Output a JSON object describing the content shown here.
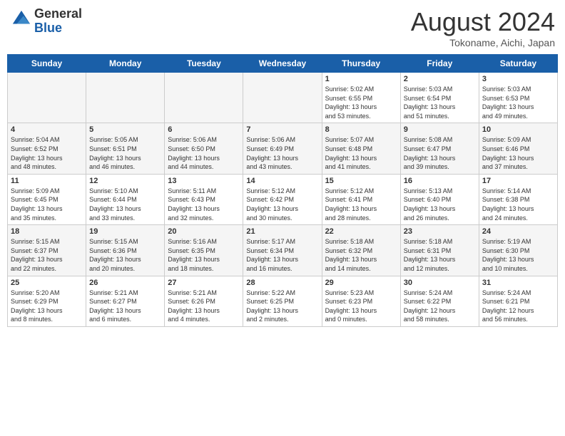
{
  "header": {
    "logo_line1": "General",
    "logo_line2": "Blue",
    "month_title": "August 2024",
    "location": "Tokoname, Aichi, Japan"
  },
  "weekdays": [
    "Sunday",
    "Monday",
    "Tuesday",
    "Wednesday",
    "Thursday",
    "Friday",
    "Saturday"
  ],
  "weeks": [
    [
      {
        "day": "",
        "info": ""
      },
      {
        "day": "",
        "info": ""
      },
      {
        "day": "",
        "info": ""
      },
      {
        "day": "",
        "info": ""
      },
      {
        "day": "1",
        "info": "Sunrise: 5:02 AM\nSunset: 6:55 PM\nDaylight: 13 hours\nand 53 minutes."
      },
      {
        "day": "2",
        "info": "Sunrise: 5:03 AM\nSunset: 6:54 PM\nDaylight: 13 hours\nand 51 minutes."
      },
      {
        "day": "3",
        "info": "Sunrise: 5:03 AM\nSunset: 6:53 PM\nDaylight: 13 hours\nand 49 minutes."
      }
    ],
    [
      {
        "day": "4",
        "info": "Sunrise: 5:04 AM\nSunset: 6:52 PM\nDaylight: 13 hours\nand 48 minutes."
      },
      {
        "day": "5",
        "info": "Sunrise: 5:05 AM\nSunset: 6:51 PM\nDaylight: 13 hours\nand 46 minutes."
      },
      {
        "day": "6",
        "info": "Sunrise: 5:06 AM\nSunset: 6:50 PM\nDaylight: 13 hours\nand 44 minutes."
      },
      {
        "day": "7",
        "info": "Sunrise: 5:06 AM\nSunset: 6:49 PM\nDaylight: 13 hours\nand 43 minutes."
      },
      {
        "day": "8",
        "info": "Sunrise: 5:07 AM\nSunset: 6:48 PM\nDaylight: 13 hours\nand 41 minutes."
      },
      {
        "day": "9",
        "info": "Sunrise: 5:08 AM\nSunset: 6:47 PM\nDaylight: 13 hours\nand 39 minutes."
      },
      {
        "day": "10",
        "info": "Sunrise: 5:09 AM\nSunset: 6:46 PM\nDaylight: 13 hours\nand 37 minutes."
      }
    ],
    [
      {
        "day": "11",
        "info": "Sunrise: 5:09 AM\nSunset: 6:45 PM\nDaylight: 13 hours\nand 35 minutes."
      },
      {
        "day": "12",
        "info": "Sunrise: 5:10 AM\nSunset: 6:44 PM\nDaylight: 13 hours\nand 33 minutes."
      },
      {
        "day": "13",
        "info": "Sunrise: 5:11 AM\nSunset: 6:43 PM\nDaylight: 13 hours\nand 32 minutes."
      },
      {
        "day": "14",
        "info": "Sunrise: 5:12 AM\nSunset: 6:42 PM\nDaylight: 13 hours\nand 30 minutes."
      },
      {
        "day": "15",
        "info": "Sunrise: 5:12 AM\nSunset: 6:41 PM\nDaylight: 13 hours\nand 28 minutes."
      },
      {
        "day": "16",
        "info": "Sunrise: 5:13 AM\nSunset: 6:40 PM\nDaylight: 13 hours\nand 26 minutes."
      },
      {
        "day": "17",
        "info": "Sunrise: 5:14 AM\nSunset: 6:38 PM\nDaylight: 13 hours\nand 24 minutes."
      }
    ],
    [
      {
        "day": "18",
        "info": "Sunrise: 5:15 AM\nSunset: 6:37 PM\nDaylight: 13 hours\nand 22 minutes."
      },
      {
        "day": "19",
        "info": "Sunrise: 5:15 AM\nSunset: 6:36 PM\nDaylight: 13 hours\nand 20 minutes."
      },
      {
        "day": "20",
        "info": "Sunrise: 5:16 AM\nSunset: 6:35 PM\nDaylight: 13 hours\nand 18 minutes."
      },
      {
        "day": "21",
        "info": "Sunrise: 5:17 AM\nSunset: 6:34 PM\nDaylight: 13 hours\nand 16 minutes."
      },
      {
        "day": "22",
        "info": "Sunrise: 5:18 AM\nSunset: 6:32 PM\nDaylight: 13 hours\nand 14 minutes."
      },
      {
        "day": "23",
        "info": "Sunrise: 5:18 AM\nSunset: 6:31 PM\nDaylight: 13 hours\nand 12 minutes."
      },
      {
        "day": "24",
        "info": "Sunrise: 5:19 AM\nSunset: 6:30 PM\nDaylight: 13 hours\nand 10 minutes."
      }
    ],
    [
      {
        "day": "25",
        "info": "Sunrise: 5:20 AM\nSunset: 6:29 PM\nDaylight: 13 hours\nand 8 minutes."
      },
      {
        "day": "26",
        "info": "Sunrise: 5:21 AM\nSunset: 6:27 PM\nDaylight: 13 hours\nand 6 minutes."
      },
      {
        "day": "27",
        "info": "Sunrise: 5:21 AM\nSunset: 6:26 PM\nDaylight: 13 hours\nand 4 minutes."
      },
      {
        "day": "28",
        "info": "Sunrise: 5:22 AM\nSunset: 6:25 PM\nDaylight: 13 hours\nand 2 minutes."
      },
      {
        "day": "29",
        "info": "Sunrise: 5:23 AM\nSunset: 6:23 PM\nDaylight: 13 hours\nand 0 minutes."
      },
      {
        "day": "30",
        "info": "Sunrise: 5:24 AM\nSunset: 6:22 PM\nDaylight: 12 hours\nand 58 minutes."
      },
      {
        "day": "31",
        "info": "Sunrise: 5:24 AM\nSunset: 6:21 PM\nDaylight: 12 hours\nand 56 minutes."
      }
    ]
  ]
}
